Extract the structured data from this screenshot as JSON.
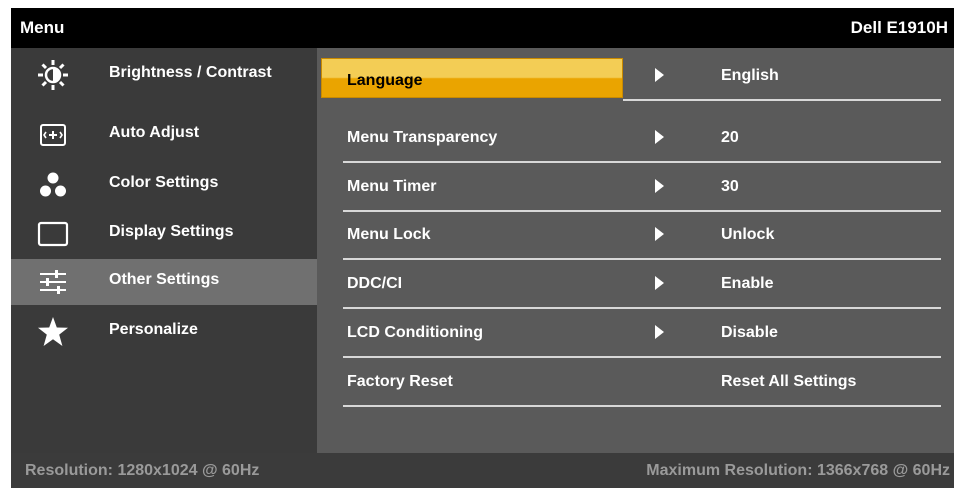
{
  "header": {
    "title": "Menu",
    "model": "Dell E1910H"
  },
  "sidebar": {
    "items": [
      {
        "label": "Brightness / Contrast",
        "icon": "brightness-icon",
        "active": false
      },
      {
        "label": "Auto Adjust",
        "icon": "auto-adjust-icon",
        "active": false
      },
      {
        "label": "Color Settings",
        "icon": "color-settings-icon",
        "active": false
      },
      {
        "label": "Display Settings",
        "icon": "display-settings-icon",
        "active": false
      },
      {
        "label": "Other Settings",
        "icon": "sliders-icon",
        "active": true
      },
      {
        "label": "Personalize",
        "icon": "star-icon",
        "active": false
      }
    ]
  },
  "settings": {
    "rows": [
      {
        "name": "Language",
        "value": "English",
        "has_arrow": true,
        "selected": true
      },
      {
        "name": "Menu Transparency",
        "value": "20",
        "has_arrow": true,
        "selected": false
      },
      {
        "name": "Menu Timer",
        "value": "30",
        "has_arrow": true,
        "selected": false
      },
      {
        "name": "Menu Lock",
        "value": "Unlock",
        "has_arrow": true,
        "selected": false
      },
      {
        "name": "DDC/CI",
        "value": "Enable",
        "has_arrow": true,
        "selected": false
      },
      {
        "name": "LCD Conditioning",
        "value": "Disable",
        "has_arrow": true,
        "selected": false
      },
      {
        "name": "Factory Reset",
        "value": "Reset All Settings",
        "has_arrow": false,
        "selected": false
      }
    ]
  },
  "footer": {
    "resolution": "Resolution: 1280x1024 @ 60Hz",
    "max_resolution": "Maximum Resolution: 1366x768 @ 60Hz"
  },
  "colors": {
    "highlight_top": "#f3cd55",
    "highlight_bottom": "#eaa400",
    "sidebar_bg": "#3a3a3a",
    "sidebar_active": "#707070",
    "content_bg": "#5a5a5a"
  }
}
